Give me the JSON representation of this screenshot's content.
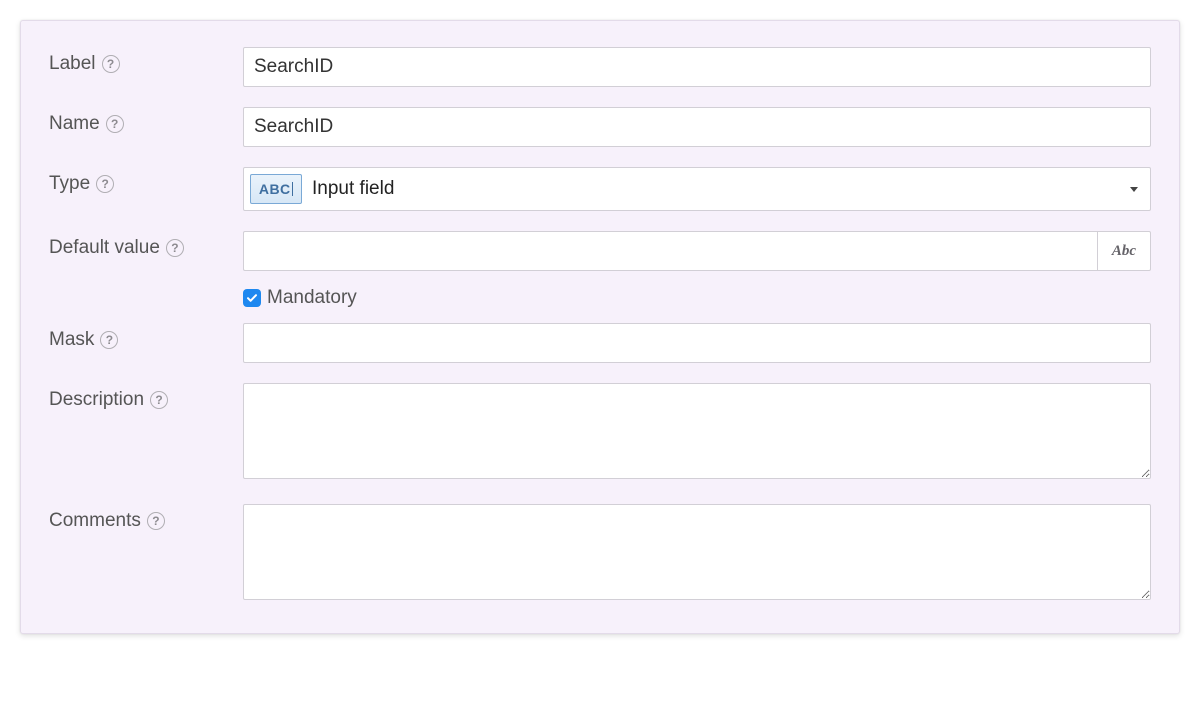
{
  "fields": {
    "label": {
      "label": "Label",
      "value": "SearchID"
    },
    "name": {
      "label": "Name",
      "value": "SearchID"
    },
    "type": {
      "label": "Type",
      "value": "Input field",
      "icon_text": "ABC"
    },
    "default": {
      "label": "Default value",
      "value": "",
      "addon_text": "Abc"
    },
    "mandatory": {
      "label": "Mandatory",
      "checked": true
    },
    "mask": {
      "label": "Mask",
      "value": ""
    },
    "description": {
      "label": "Description",
      "value": ""
    },
    "comments": {
      "label": "Comments",
      "value": ""
    }
  },
  "help_glyph": "?"
}
